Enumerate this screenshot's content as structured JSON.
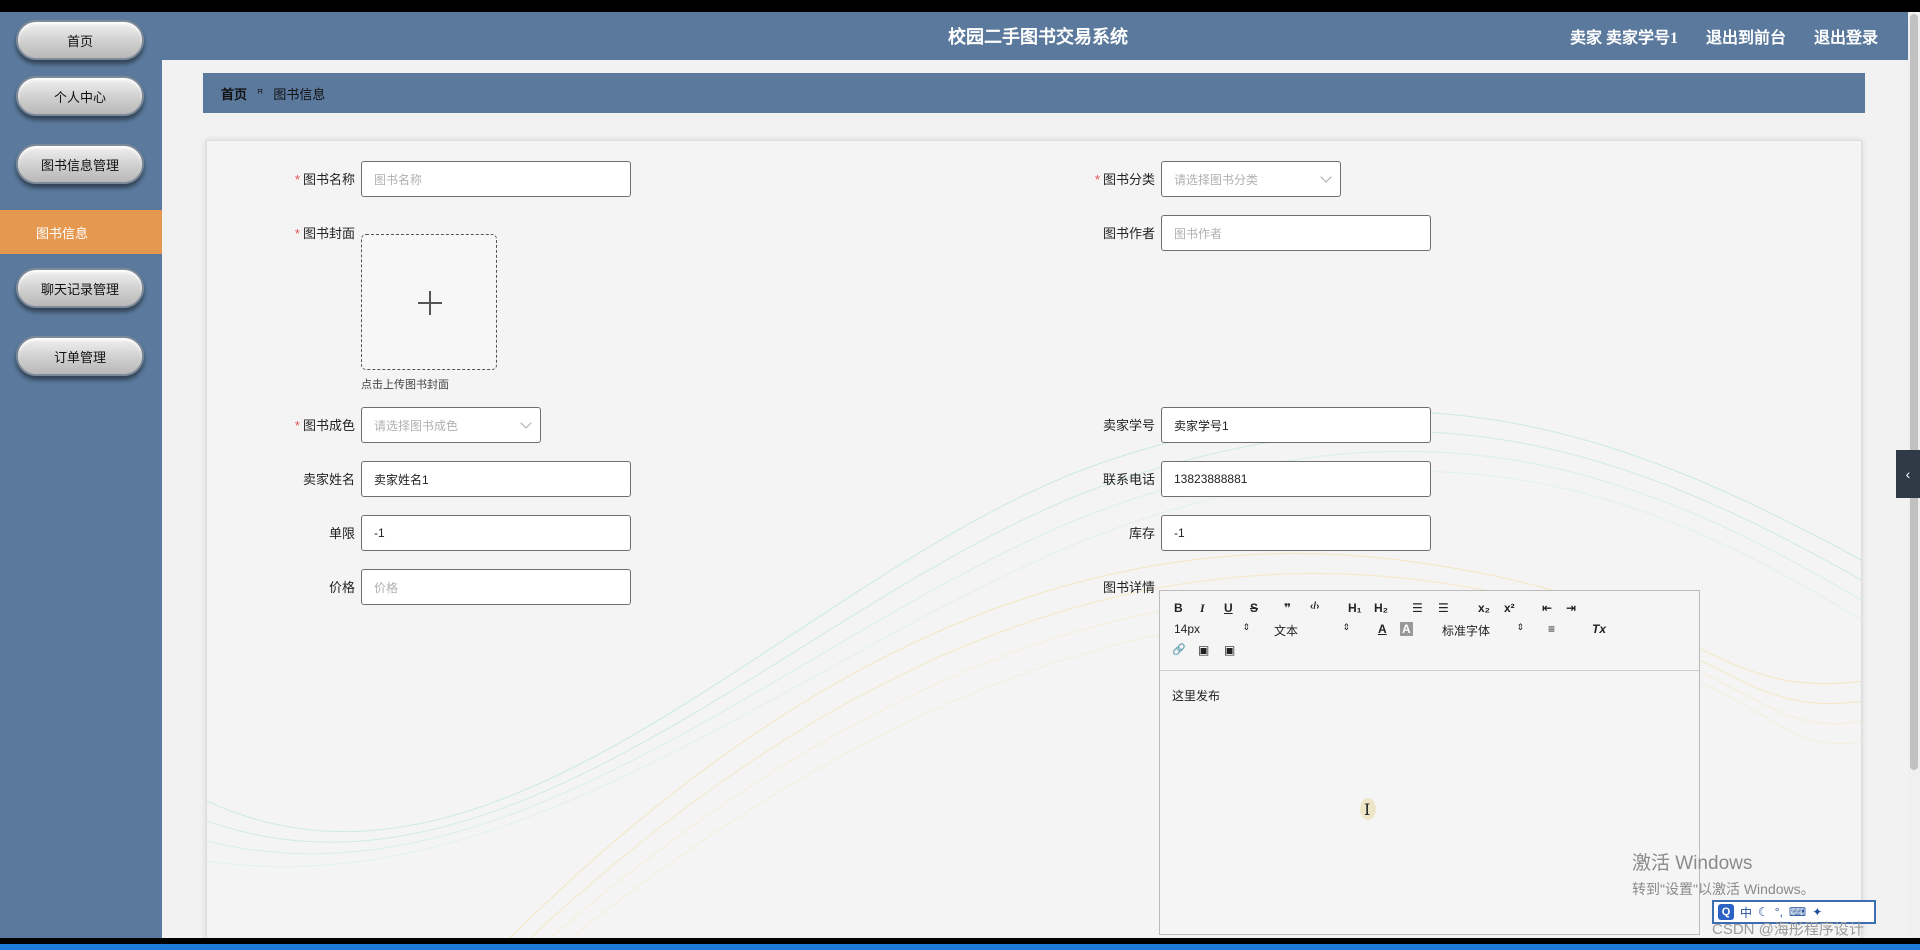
{
  "sidebar": {
    "items": [
      {
        "label": "首页"
      },
      {
        "label": "个人中心"
      },
      {
        "label": "图书信息管理"
      },
      {
        "label": "图书信息"
      },
      {
        "label": "聊天记录管理"
      },
      {
        "label": "订单管理"
      }
    ]
  },
  "header": {
    "title": "校园二手图书交易系统",
    "user": "卖家  卖家学号1",
    "to_front": "退出到前台",
    "logout": "退出登录"
  },
  "breadcrumb": {
    "home": "首页",
    "separator": "ꟸ",
    "current": "图书信息"
  },
  "form": {
    "book_name": {
      "label": "图书名称",
      "placeholder": "图书名称"
    },
    "category": {
      "label": "图书分类",
      "placeholder": "请选择图书分类"
    },
    "cover": {
      "label": "图书封面",
      "tip": "点击上传图书封面"
    },
    "author": {
      "label": "图书作者",
      "placeholder": "图书作者"
    },
    "condition": {
      "label": "图书成色",
      "placeholder": "请选择图书成色"
    },
    "seller_id": {
      "label": "卖家学号",
      "value": "卖家学号1"
    },
    "seller_name": {
      "label": "卖家姓名",
      "value": "卖家姓名1"
    },
    "phone": {
      "label": "联系电话",
      "value": "13823888881"
    },
    "limit": {
      "label": "单限",
      "value": "-1"
    },
    "stock": {
      "label": "库存",
      "value": "-1"
    },
    "price": {
      "label": "价格",
      "placeholder": "价格"
    },
    "details": {
      "label": "图书详情",
      "content": "这里发布"
    }
  },
  "editor_toolbar": {
    "bold": "B",
    "italic": "I",
    "underline": "U",
    "strike": "S",
    "quote": "❞",
    "code": "‹/›",
    "h1": "H₁",
    "h2": "H₂",
    "ordered_list": "☰",
    "bullet_list": "☰",
    "subscript": "x₂",
    "superscript": "x²",
    "outdent": "⇤",
    "indent": "⇥",
    "size": "14px",
    "text_type": "文本",
    "font_color": "A",
    "bg_color": "A",
    "font": "标准字体",
    "align": "≡",
    "clear_format": "Tx",
    "link": "🔗",
    "image": "▣",
    "video": "▣",
    "spin": "⇕"
  },
  "overlay": {
    "activate_title": "激活 Windows",
    "activate_sub": "转到\"设置\"以激活 Windows。",
    "watermark": "CSDN @海彤程序设计",
    "ime": "中",
    "handle": "‹"
  },
  "colors": {
    "header_bg": "#5a799c",
    "active_menu": "#e5984f",
    "required": "#e25555"
  }
}
